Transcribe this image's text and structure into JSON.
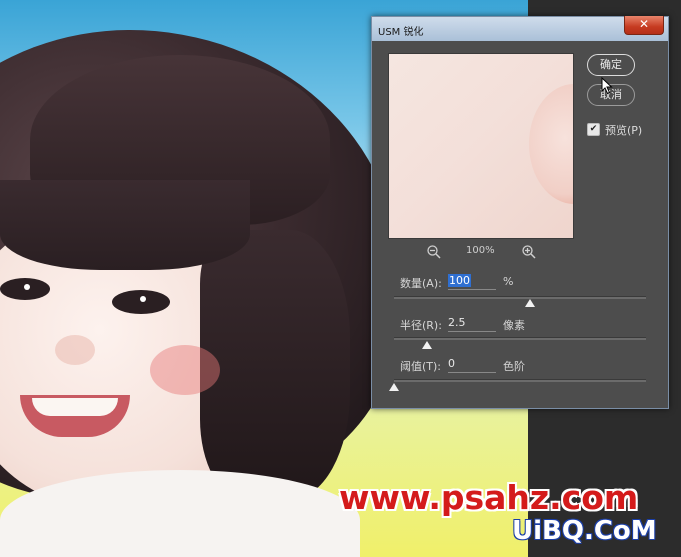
{
  "dialog": {
    "title": "USM 锐化",
    "close_glyph": "✕",
    "ok_label": "确定",
    "cancel_label": "取消",
    "preview_label": "预览(P)",
    "preview_checked": true,
    "zoom_out_icon": "zoom-out-icon",
    "zoom_in_icon": "zoom-in-icon",
    "zoom_value": "100%",
    "amount": {
      "label": "数量(A):",
      "value": "100",
      "unit": "%",
      "slider_fraction": 0.54
    },
    "radius": {
      "label": "半径(R):",
      "value": "2.5",
      "unit": "像素",
      "slider_fraction": 0.13
    },
    "threshold": {
      "label": "阈值(T):",
      "value": "0",
      "unit": "色阶",
      "slider_fraction": 0.0
    }
  },
  "watermarks": {
    "primary": "www.psahz.com",
    "secondary": "UiBQ.CoM"
  }
}
